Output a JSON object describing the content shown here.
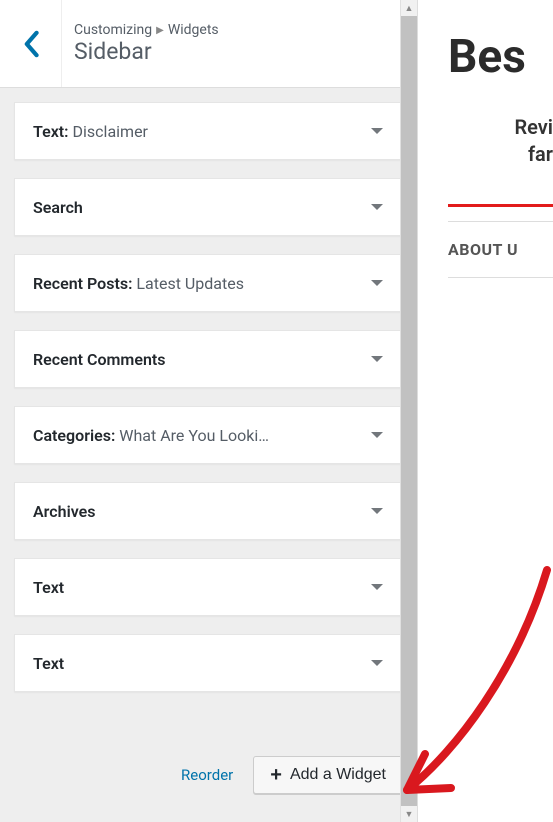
{
  "header": {
    "breadcrumb_root": "Customizing",
    "breadcrumb_leaf": "Widgets",
    "title": "Sidebar"
  },
  "widgets": [
    {
      "label": "Text",
      "subtitle": "Disclaimer"
    },
    {
      "label": "Search",
      "subtitle": ""
    },
    {
      "label": "Recent Posts",
      "subtitle": "Latest Updates"
    },
    {
      "label": "Recent Comments",
      "subtitle": ""
    },
    {
      "label": "Categories",
      "subtitle": "What Are You Looki…"
    },
    {
      "label": "Archives",
      "subtitle": ""
    },
    {
      "label": "Text",
      "subtitle": ""
    },
    {
      "label": "Text",
      "subtitle": ""
    }
  ],
  "footer": {
    "reorder": "Reorder",
    "add": "Add a Widget"
  },
  "preview": {
    "title": "Bes",
    "sub1": "Revi",
    "sub2": "far",
    "about": "ABOUT U"
  }
}
